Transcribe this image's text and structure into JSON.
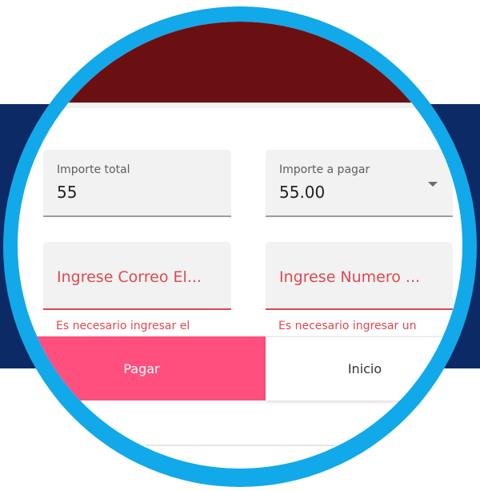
{
  "form": {
    "total": {
      "label": "Importe total",
      "value": "55"
    },
    "pay": {
      "label": "Importe a pagar",
      "value": "55.00"
    },
    "email": {
      "placeholder": "Ingrese Correo El...",
      "error": "Es necesario ingresar el"
    },
    "number": {
      "placeholder": "Ingrese Numero ...",
      "error": "Es necesario ingresar un"
    }
  },
  "actions": {
    "pay_label": "Pagar",
    "home_label": "Inicio"
  },
  "colors": {
    "app_bar": "#6b1012",
    "ring": "#12a9ea",
    "band": "#0b2a66",
    "primary_button": "#ff4f7f",
    "error": "#e0484f"
  },
  "icons": {
    "dropdown": "chevron-down-icon"
  }
}
